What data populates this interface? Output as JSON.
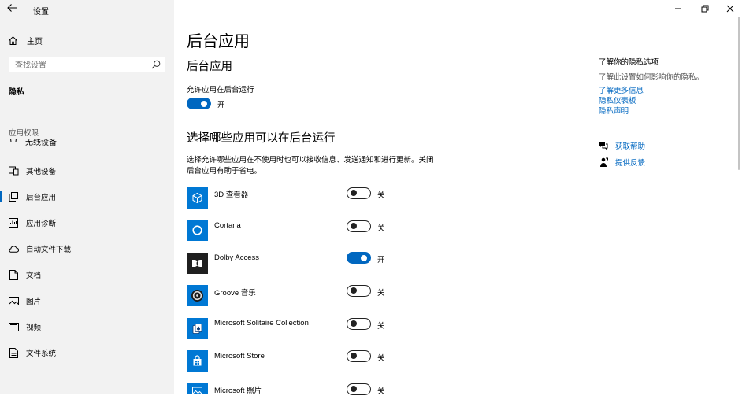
{
  "window": {
    "title": "设置"
  },
  "sidebar": {
    "home_label": "主页",
    "search_placeholder": "查找设置",
    "section_title": "隐私",
    "group_title": "应用权限",
    "items": [
      {
        "label": "无线设备",
        "icon": "radio-tower-icon",
        "active": false
      },
      {
        "label": "其他设备",
        "icon": "devices-icon",
        "active": false
      },
      {
        "label": "后台应用",
        "icon": "background-apps-icon",
        "active": true
      },
      {
        "label": "应用诊断",
        "icon": "diagnostics-icon",
        "active": false
      },
      {
        "label": "自动文件下载",
        "icon": "cloud-icon",
        "active": false
      },
      {
        "label": "文档",
        "icon": "document-icon",
        "active": false
      },
      {
        "label": "图片",
        "icon": "pictures-icon",
        "active": false
      },
      {
        "label": "视频",
        "icon": "video-icon",
        "active": false
      },
      {
        "label": "文件系统",
        "icon": "file-system-icon",
        "active": false
      }
    ]
  },
  "main": {
    "page_title": "后台应用",
    "section_title": "后台应用",
    "allow_caption": "允许应用在后台运行",
    "allow_state": "开",
    "choose_title": "选择哪些应用可以在后台运行",
    "choose_desc": "选择允许哪些应用在不使用时也可以接收信息、发送通知和进行更新。关闭后台应用有助于省电。",
    "apps": [
      {
        "name": "3D 查看器",
        "state": "关",
        "on": false,
        "icon": "3d-viewer-icon",
        "tile_color": "#0078d4"
      },
      {
        "name": "Cortana",
        "state": "关",
        "on": false,
        "icon": "cortana-icon",
        "tile_color": "#0078d4"
      },
      {
        "name": "Dolby Access",
        "state": "开",
        "on": true,
        "icon": "dolby-icon",
        "tile_color": "#1f1f1f"
      },
      {
        "name": "Groove 音乐",
        "state": "关",
        "on": false,
        "icon": "groove-music-icon",
        "tile_color": "#0078d4"
      },
      {
        "name": "Microsoft Solitaire Collection",
        "state": "关",
        "on": false,
        "icon": "solitaire-icon",
        "tile_color": "#0078d4"
      },
      {
        "name": "Microsoft Store",
        "state": "关",
        "on": false,
        "icon": "store-icon",
        "tile_color": "#0078d4"
      },
      {
        "name": "Microsoft 照片",
        "state": "关",
        "on": false,
        "icon": "photos-icon",
        "tile_color": "#0078d4"
      }
    ]
  },
  "right_panel": {
    "title": "了解你的隐私选项",
    "subtitle": "了解此设置如何影响你的隐私。",
    "links": [
      "了解更多信息",
      "隐私仪表板",
      "隐私声明"
    ],
    "help_label": "获取帮助",
    "feedback_label": "提供反馈"
  },
  "colors": {
    "accent": "#0067c0",
    "sidebar_bg": "#f2f2f2",
    "tile_blue": "#0078d4"
  }
}
